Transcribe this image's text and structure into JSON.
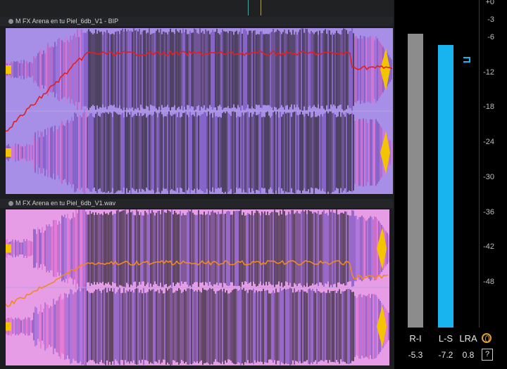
{
  "tracks": [
    {
      "title": "M FX Arena en tu Piel_6db_V1 - BIP"
    },
    {
      "title": "M FX Arena en tu Piel_6db_V1.wav"
    }
  ],
  "meter": {
    "scale": [
      "+0",
      "-3",
      "-6",
      "-12",
      "-18",
      "-24",
      "-30",
      "-36",
      "-42",
      "-48"
    ],
    "bars": [
      {
        "name": "R-I",
        "value": "-5.3",
        "level_db": -5.3,
        "color": "#8c8c8c"
      },
      {
        "name": "L-S",
        "value": "-7.2",
        "level_db": -7.2,
        "color": "#18b4f0"
      },
      {
        "name": "LRA",
        "value": "0.8"
      }
    ],
    "help_label": "?"
  },
  "colors": {
    "clip1_bg": "#a78ee6",
    "clip2_bg": "#e79ce6",
    "waveform_dark": "#2b2530",
    "loudness_line_1": "#e02020",
    "loudness_line_2": "#f08a20",
    "peak_yellow": "#f5c400",
    "meter_blue": "#18b4f0"
  }
}
